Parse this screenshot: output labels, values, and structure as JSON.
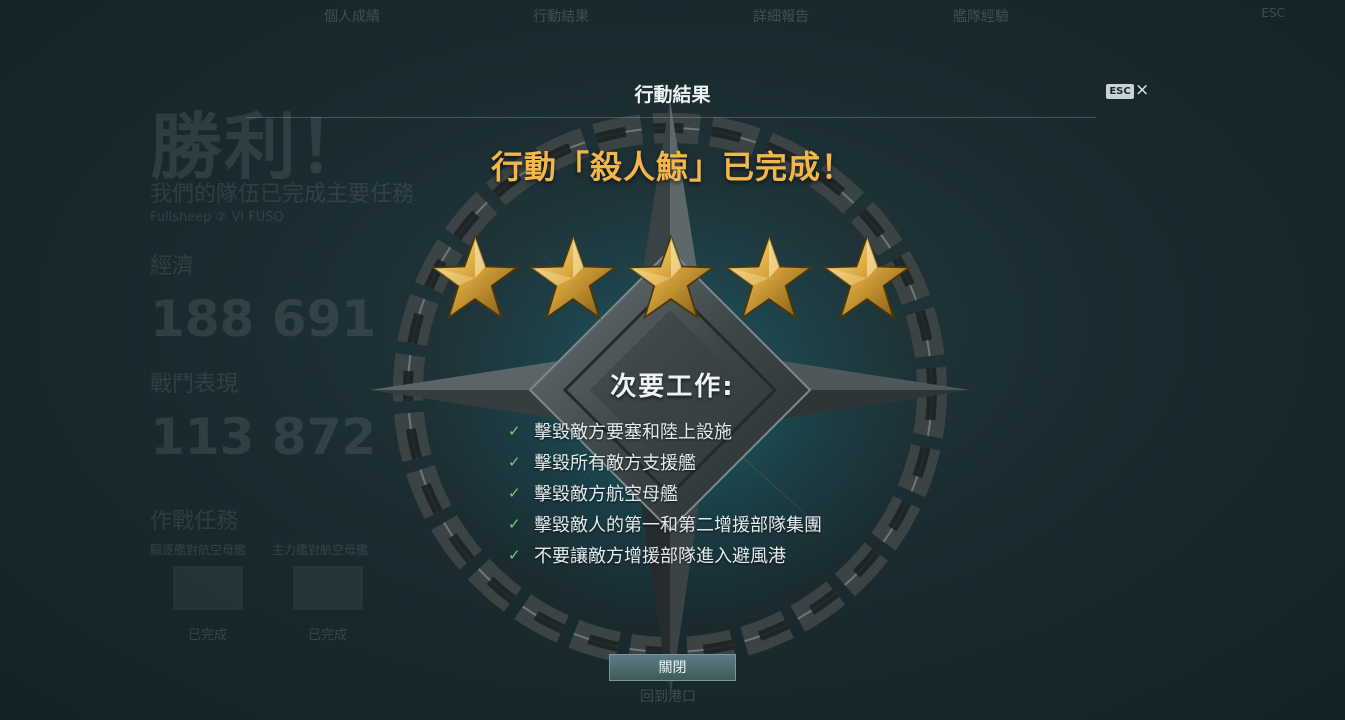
{
  "background": {
    "tabs": [
      "個人成績",
      "行動結果",
      "詳細報告",
      "艦隊經驗",
      "ESC"
    ],
    "victory_title": "勝利！",
    "victory_subtitle": "我們的隊伍已完成主要任務",
    "player": "Fullsheep ② VI FUSO",
    "section_1": "經濟",
    "number_1": "188 691",
    "section_2": "戰鬥表現",
    "number_2": "113 872",
    "section_3": "作戰任務",
    "task_cards": [
      "驅逐艦對航空母艦",
      "主力艦對航空母艦"
    ],
    "card_status": "已完成",
    "back_link": "回到港口"
  },
  "modal": {
    "title": "行動結果",
    "esc_label": "ESC",
    "close_icon": "×",
    "headline": "行動「殺人鯨」已完成！",
    "stars_earned": 5,
    "secondary_title": "次要工作:",
    "check_icon": "✓",
    "secondary_tasks": [
      "擊毀敵方要塞和陸上設施",
      "擊毀所有敵方支援艦",
      "擊毀敵方航空母艦",
      "擊毀敵人的第一和第二增援部隊集團",
      "不要讓敵方增援部隊進入避風港"
    ],
    "close_button": "關閉"
  },
  "colors": {
    "headline": "#f3b64a",
    "check": "#6fd07a",
    "star_gold": "#d9a63c"
  }
}
